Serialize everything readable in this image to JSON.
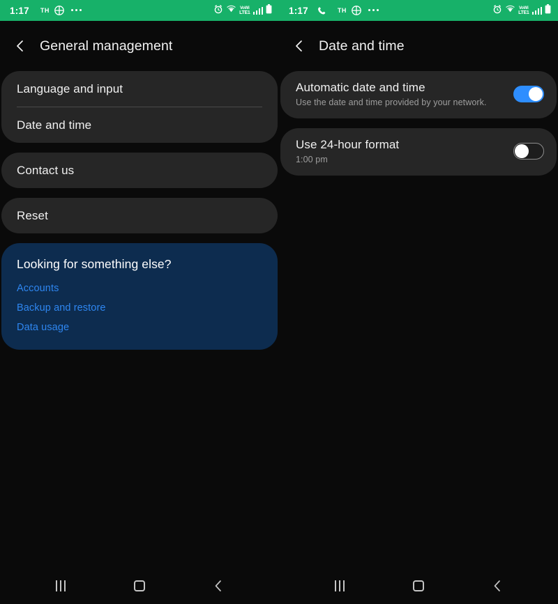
{
  "statusbar": {
    "left": {
      "clock": "1:17",
      "carrier": "TH",
      "icons": [
        "grid-icon",
        "overflow-dots-icon"
      ],
      "right_icons": [
        "alarm-icon",
        "wifi-icon",
        "volte-icon",
        "signal-icon",
        "battery-icon"
      ],
      "volte_top": "VoWi",
      "volte_bottom": "LTE1"
    },
    "right": {
      "clock": "1:17",
      "carrier": "TH",
      "icons": [
        "phone-icon",
        "grid-icon",
        "overflow-dots-icon"
      ],
      "right_icons": [
        "alarm-icon",
        "wifi-icon",
        "volte-icon",
        "signal-icon",
        "battery-icon"
      ],
      "volte_top": "VoWi",
      "volte_bottom": "LTE1"
    },
    "background_color": "#17b169"
  },
  "left_panel": {
    "appbar": {
      "title": "General management",
      "back": "back-icon"
    },
    "card_menu": {
      "items": [
        {
          "label": "Language and input"
        },
        {
          "label": "Date and time"
        }
      ]
    },
    "card_contact": {
      "label": "Contact us"
    },
    "card_reset": {
      "label": "Reset"
    },
    "card_suggestions": {
      "title": "Looking for something else?",
      "links": [
        {
          "label": "Accounts"
        },
        {
          "label": "Backup and restore"
        },
        {
          "label": "Data usage"
        }
      ],
      "background_color": "#0d2c4f",
      "link_color": "#2e86f0"
    }
  },
  "right_panel": {
    "appbar": {
      "title": "Date and time",
      "back": "back-icon"
    },
    "settings": [
      {
        "title": "Automatic date and time",
        "subtitle": "Use the date and time provided by your network.",
        "toggle": "on"
      },
      {
        "title": "Use 24-hour format",
        "subtitle": "1:00 pm",
        "toggle": "off"
      }
    ],
    "toggle_on_color": "#2e8eff"
  },
  "navbar": {
    "buttons": [
      {
        "name": "recents-icon"
      },
      {
        "name": "home-icon"
      },
      {
        "name": "back-icon"
      }
    ]
  }
}
